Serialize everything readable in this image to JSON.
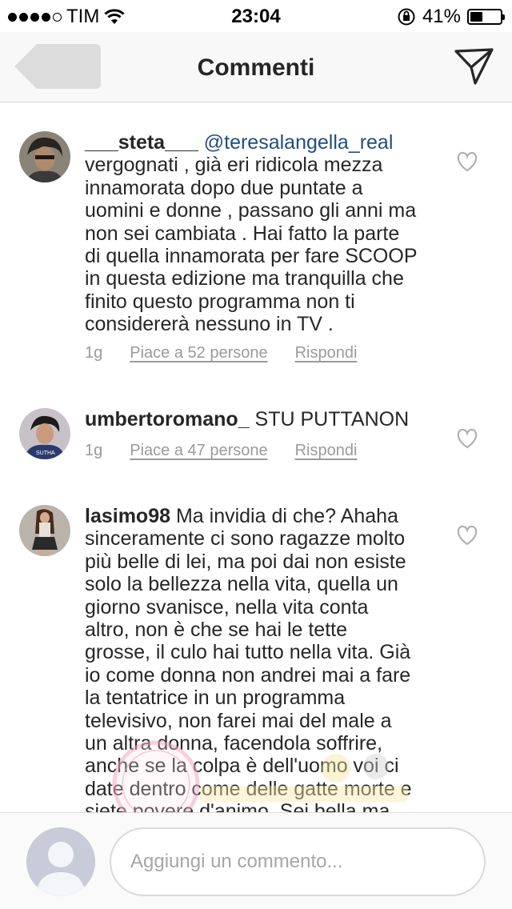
{
  "status_bar": {
    "carrier": "TIM",
    "time": "23:04",
    "battery_percent": "41%",
    "battery_level": 0.41
  },
  "nav": {
    "title": "Commenti",
    "back_icon": "back-arrow-icon",
    "share_icon": "send-paper-plane-icon"
  },
  "comments": [
    {
      "username": "___steta___",
      "mention": "@teresalangella_real",
      "text_lines": [
        "vergognati , già eri ridicola mezza",
        "innamorata dopo due puntate a",
        "uomini e donne , passano gli anni ma",
        "non sei cambiata . Hai fatto la parte",
        "di quella innamorata per fare SCOOP",
        "in questa edizione ma tranquilla che",
        "finito questo programma non ti",
        "considererà nessuno in TV ."
      ],
      "time": "1g",
      "likes": "Piace a 52 persone",
      "reply": "Rispondi"
    },
    {
      "username": "umbertoromano_",
      "text_lines": [
        "STU PUTTANON"
      ],
      "time": "1g",
      "likes": "Piace a 47 persone",
      "reply": "Rispondi"
    },
    {
      "username": "lasimo98",
      "text_lines": [
        "Ma invidia di che? Ahaha",
        "sinceramente ci sono ragazze molto",
        "più belle di lei, ma poi dai non esiste",
        "solo la bellezza nella vita, quella un",
        "giorno svanisce, nella vita conta",
        "altro, non è che se hai le tette",
        "grosse, il culo hai tutto nella vita. Già",
        "io come donna non andrei mai a fare",
        "la tentatrice in un programma",
        "televisivo, non farei mai del male a",
        "un altra donna, facendola soffrire,",
        "anche se la colpa è dell'uomo voi ci",
        "date dentro come delle gatte morte e",
        "siete povere d'animo. Sei bella ma"
      ]
    }
  ],
  "input": {
    "placeholder": "Aggiungi un commento..."
  },
  "colors": {
    "mention": "#1f4f7e",
    "meta": "#9a9a9a",
    "nav_background": "#f8f8f8"
  }
}
